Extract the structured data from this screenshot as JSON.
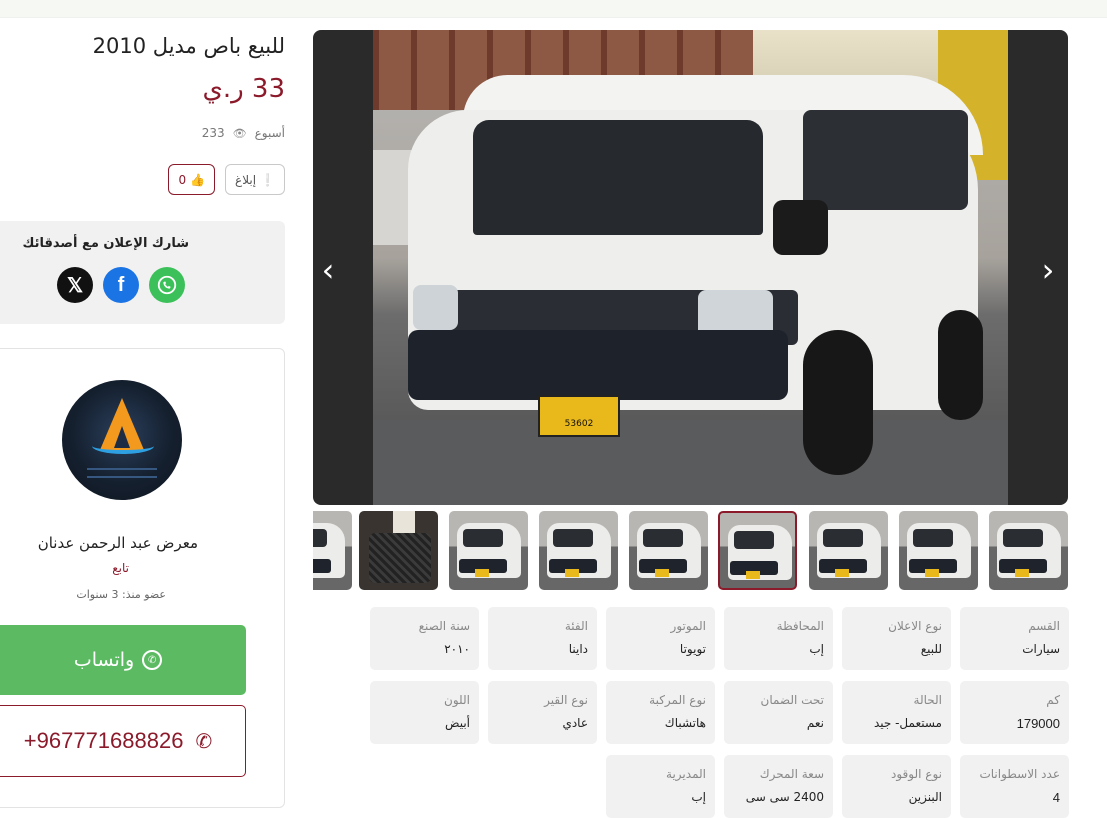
{
  "listing": {
    "title": "للبيع باص مديل 2010",
    "price": "33 ر.ي",
    "posted": "أسبوع",
    "views": "233",
    "report_label": "إبلاغ",
    "likes": "0"
  },
  "share": {
    "label": "شارك الإعلان مع أصدقائك",
    "icons": [
      "whatsapp-icon",
      "facebook-icon",
      "x-icon"
    ]
  },
  "seller": {
    "name": "معرض عبد الرحمن عدنان",
    "follow": "تابع",
    "since_label": "عضو منذ:",
    "since_value": "3 سنوات"
  },
  "contact": {
    "whatsapp_label": "واتساب",
    "phone": "+967771688826"
  },
  "gallery": {
    "plate_text": "53602",
    "thumb_count": 9,
    "active_index": 6
  },
  "specs": [
    [
      {
        "key": "القسم",
        "value": "سيارات"
      },
      {
        "key": "نوع الاعلان",
        "value": "للبيع"
      },
      {
        "key": "المحافظة",
        "value": "إب"
      },
      {
        "key": "الموتور",
        "value": "تويوتا"
      },
      {
        "key": "الفئة",
        "value": "داينا"
      },
      {
        "key": "سنة الصنع",
        "value": "٢٠١٠"
      }
    ],
    [
      {
        "key": "كم",
        "value": "179000"
      },
      {
        "key": "الحالة",
        "value": "مستعمل- جيد"
      },
      {
        "key": "تحت الضمان",
        "value": "نعم"
      },
      {
        "key": "نوع المركبة",
        "value": "هاتشباك"
      },
      {
        "key": "نوع القير",
        "value": "عادي"
      },
      {
        "key": "اللون",
        "value": "أبيض"
      }
    ],
    [
      {
        "key": "عدد الاسطوانات",
        "value": "4"
      },
      {
        "key": "نوع الوقود",
        "value": "البنزين"
      },
      {
        "key": "سعة المحرك",
        "value": "2400 سى سى"
      },
      {
        "key": "المديرية",
        "value": "إب"
      }
    ]
  ],
  "colors": {
    "accent": "#8b1a2b",
    "whatsapp": "#5cbb62",
    "facebook": "#1b74e4",
    "card_bg": "#f1f1f1"
  }
}
